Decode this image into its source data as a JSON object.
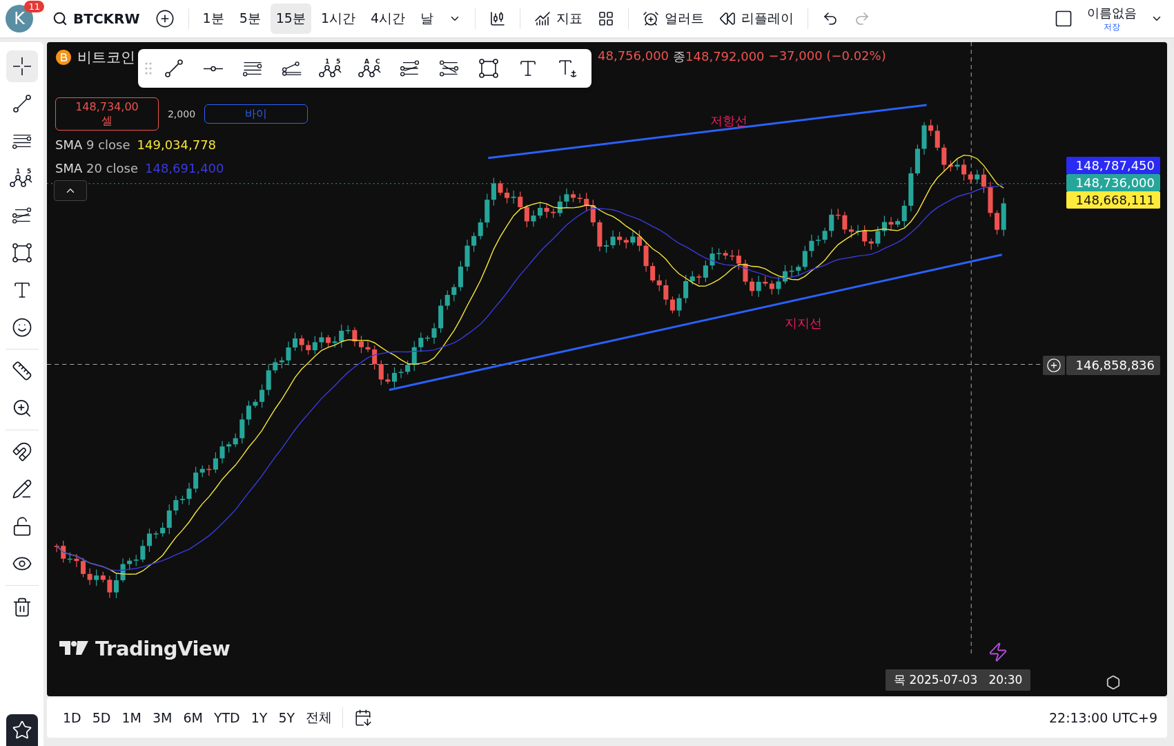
{
  "top_bar": {
    "avatar": {
      "letter": "K",
      "badge": "11"
    },
    "symbol": "BTCKRW",
    "intervals": [
      {
        "label": "1분",
        "selected": false
      },
      {
        "label": "5분",
        "selected": false
      },
      {
        "label": "15분",
        "selected": true
      },
      {
        "label": "1시간",
        "selected": false
      },
      {
        "label": "4시간",
        "selected": false
      },
      {
        "label": "날",
        "selected": false
      }
    ],
    "indicators": "지표",
    "alert": "얼러트",
    "replay": "리플레이",
    "layout": {
      "name": "이름없음",
      "status": "저장"
    }
  },
  "drawing_tools": [
    {
      "kind": "crosshair",
      "selected": true
    },
    {
      "kind": "trendline",
      "selected": false
    },
    {
      "kind": "fib",
      "selected": false
    },
    {
      "kind": "pattern",
      "selected": false,
      "labels": [
        "1",
        "5"
      ]
    },
    {
      "kind": "projection",
      "selected": false
    },
    {
      "kind": "rectangle",
      "selected": false
    },
    {
      "kind": "text",
      "selected": false
    },
    {
      "kind": "emoji",
      "selected": false
    },
    {
      "kind": "divider"
    },
    {
      "kind": "ruler",
      "selected": false
    },
    {
      "kind": "zoom",
      "selected": false
    },
    {
      "kind": "divider"
    },
    {
      "kind": "magnet",
      "selected": false
    },
    {
      "kind": "lock-draw",
      "selected": false
    },
    {
      "kind": "lock",
      "selected": false
    },
    {
      "kind": "eye",
      "selected": false
    },
    {
      "kind": "divider"
    },
    {
      "kind": "trash",
      "selected": false
    },
    {
      "kind": "star"
    }
  ],
  "floating_toolbar": [
    {
      "kind": "trendline"
    },
    {
      "kind": "ray"
    },
    {
      "kind": "fib"
    },
    {
      "kind": "pitchfork"
    },
    {
      "kind": "pattern",
      "labels": [
        "1",
        "5"
      ]
    },
    {
      "kind": "pattern",
      "labels": [
        "A",
        "C"
      ]
    },
    {
      "kind": "projection"
    },
    {
      "kind": "projection2"
    },
    {
      "kind": "rectangle"
    },
    {
      "kind": "text"
    },
    {
      "kind": "anchored-text"
    }
  ],
  "chart": {
    "symbol_name": "비트코인",
    "ohlc_fragment": "48,756,000",
    "close_label": "종",
    "close_value": "148,792,000",
    "change": "−37,000 (−0.02%)",
    "sell": {
      "price": "148,734,00",
      "label": "셀"
    },
    "spread": "2,000",
    "buy": {
      "label": "바이"
    },
    "indicators": [
      {
        "name": "SMA",
        "params": "9 close",
        "value": "149,034,778",
        "color": "#f5e53b"
      },
      {
        "name": "SMA",
        "params": "20 close",
        "value": "148,691,400",
        "color": "#3a3ae0"
      }
    ],
    "annotations": {
      "resistance": "저항선",
      "support": "지지선"
    },
    "price_labels": [
      {
        "value": "148,787,450",
        "color": "#2a2af5"
      },
      {
        "value": "148,736,000",
        "color": "#26a69a"
      },
      {
        "value": "148,668,111",
        "color": "#ffeb3b"
      }
    ],
    "crosshair_price": "146,858,836",
    "crosshair_time": "목 2025-07-03   20:30",
    "logo": "TradingView"
  },
  "bottom_bar": {
    "ranges": [
      "1D",
      "5D",
      "1M",
      "3M",
      "6M",
      "YTD",
      "1Y",
      "5Y",
      "전체"
    ],
    "time": "22:13:00 UTC+9"
  }
}
